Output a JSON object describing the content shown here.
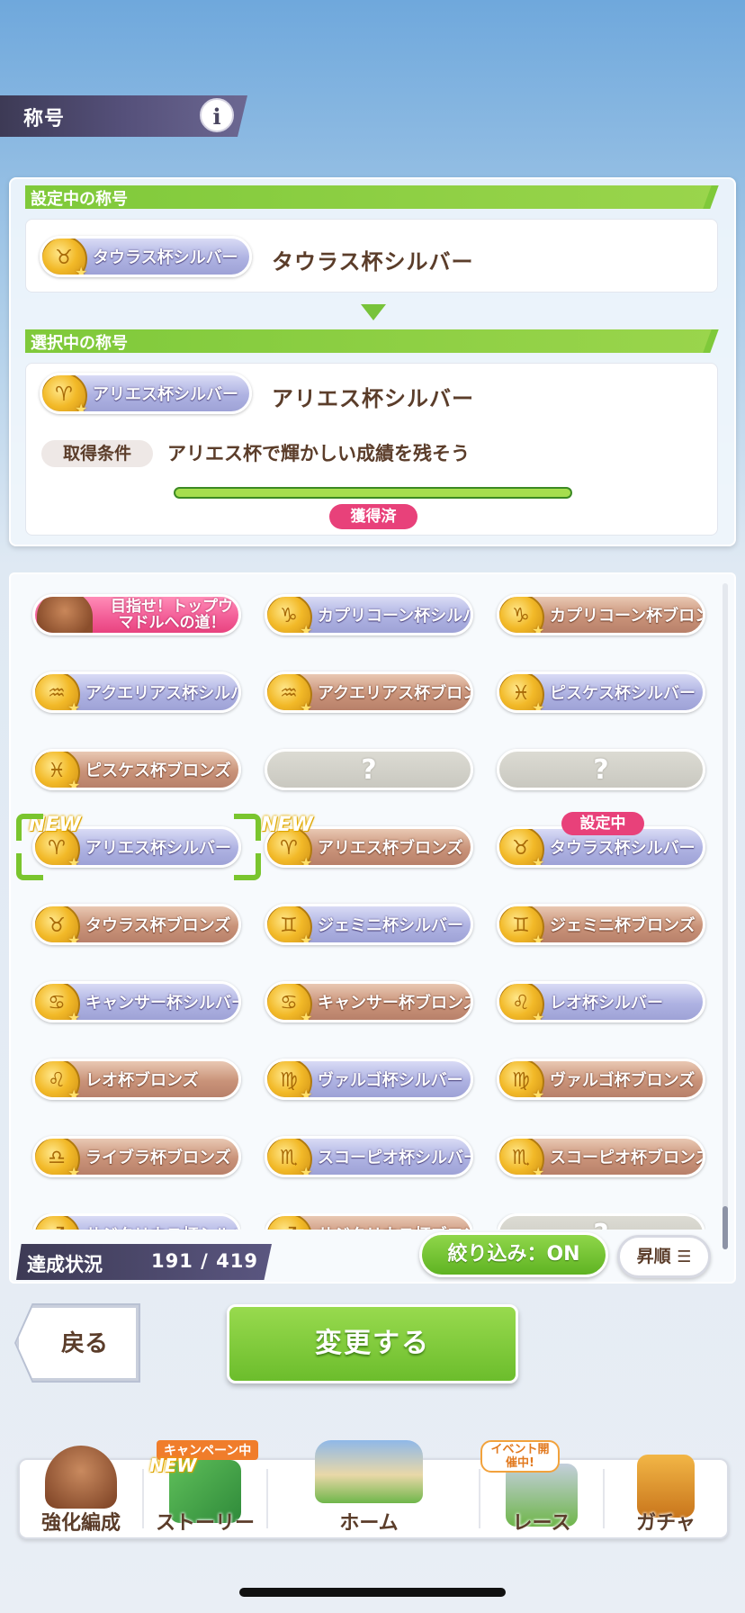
{
  "header": {
    "title": "称号",
    "info_icon": "i"
  },
  "current": {
    "section_label": "設定中の称号",
    "badge_label": "タウラス杯シルバー",
    "title_text": "タウラス杯シルバー"
  },
  "selected": {
    "section_label": "選択中の称号",
    "badge_label": "アリエス杯シルバー",
    "title_text": "アリエス杯シルバー",
    "condition_label": "取得条件",
    "condition_text": "アリエス杯で輝かしい成績を残そう",
    "progress": 1.0,
    "status_badge": "獲得済"
  },
  "grid": {
    "rows": [
      [
        {
          "label": "目指せ！トップウマドルへの道！",
          "kind": "special"
        },
        {
          "label": "カプリコーン杯シルバー",
          "kind": "silver"
        },
        {
          "label": "カプリコーン杯ブロンズ",
          "kind": "bronze"
        }
      ],
      [
        {
          "label": "アクエリアス杯シルバー",
          "kind": "silver"
        },
        {
          "label": "アクエリアス杯ブロンズ",
          "kind": "bronze"
        },
        {
          "label": "ピスケス杯シルバー",
          "kind": "silver"
        }
      ],
      [
        {
          "label": "ピスケス杯ブロンズ",
          "kind": "bronze"
        },
        {
          "label": "?",
          "kind": "locked"
        },
        {
          "label": "?",
          "kind": "locked"
        }
      ],
      [
        {
          "label": "アリエス杯シルバー",
          "kind": "silver"
        },
        {
          "label": "アリエス杯ブロンズ",
          "kind": "bronze"
        },
        {
          "label": "タウラス杯シルバー",
          "kind": "silver"
        }
      ],
      [
        {
          "label": "タウラス杯ブロンズ",
          "kind": "bronze"
        },
        {
          "label": "ジェミニ杯シルバー",
          "kind": "silver"
        },
        {
          "label": "ジェミニ杯ブロンズ",
          "kind": "bronze"
        }
      ],
      [
        {
          "label": "キャンサー杯シルバー",
          "kind": "silver"
        },
        {
          "label": "キャンサー杯ブロンズ",
          "kind": "bronze"
        },
        {
          "label": "レオ杯シルバー",
          "kind": "silver"
        }
      ],
      [
        {
          "label": "レオ杯ブロンズ",
          "kind": "bronze"
        },
        {
          "label": "ヴァルゴ杯シルバー",
          "kind": "silver"
        },
        {
          "label": "ヴァルゴ杯ブロンズ",
          "kind": "bronze"
        }
      ],
      [
        {
          "label": "ライブラ杯ブロンズ",
          "kind": "bronze"
        },
        {
          "label": "スコーピオ杯シルバー",
          "kind": "silver"
        },
        {
          "label": "スコーピオ杯ブロンズ",
          "kind": "bronze"
        }
      ],
      [
        {
          "label": "サジタリウス杯シルバー",
          "kind": "silver"
        },
        {
          "label": "サジタリウス杯ブロンズ",
          "kind": "bronze"
        },
        {
          "label": "?",
          "kind": "locked"
        }
      ]
    ],
    "new_tag": "NEW",
    "set_tag": "設定中"
  },
  "footer_bar": {
    "achievement_label": "達成状況",
    "achievement_count": "191 / 419",
    "filter_label": "絞り込み：ON",
    "sort_label": "昇順"
  },
  "actions": {
    "back_label": "戻る",
    "change_label": "変更する"
  },
  "nav": {
    "items": [
      {
        "label": "強化編成"
      },
      {
        "label": "ストーリー",
        "tag": "キャンペーン中",
        "new": "NEW"
      },
      {
        "label": "ホーム"
      },
      {
        "label": "レース",
        "tag": "イベント開催中!"
      },
      {
        "label": "ガチャ"
      }
    ]
  },
  "colors": {
    "accent_green": "#7fc93a",
    "badge_pink": "#e8417a",
    "text_brown": "#5b3d2a"
  }
}
